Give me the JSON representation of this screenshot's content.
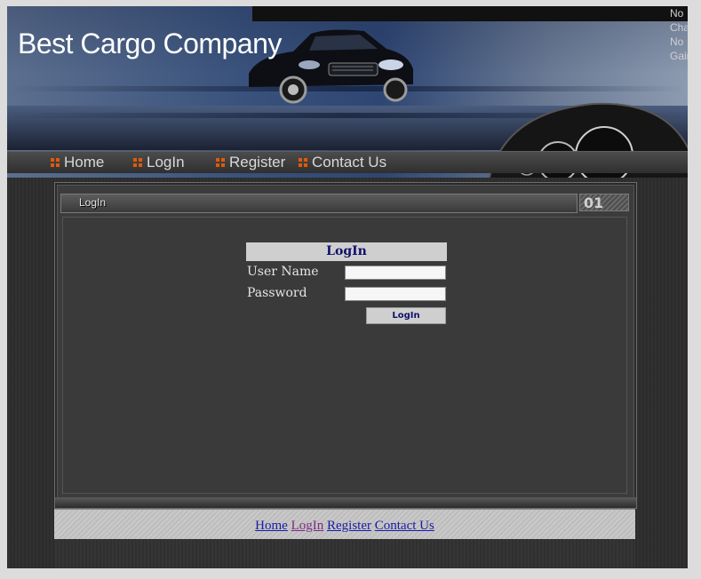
{
  "header": {
    "tagline": "No Chains, No Gains",
    "brand": "Best Cargo Company"
  },
  "nav": {
    "items": [
      {
        "label": "Home"
      },
      {
        "label": "LogIn"
      },
      {
        "label": "Register"
      },
      {
        "label": "Contact Us"
      }
    ]
  },
  "panel": {
    "title": "LogIn",
    "number": "01"
  },
  "login": {
    "heading": "LogIn",
    "username_label": "User Name",
    "username_value": "",
    "password_label": "Password",
    "password_value": "",
    "submit_label": "LogIn"
  },
  "footer": {
    "links": [
      {
        "label": "Home"
      },
      {
        "label": "LogIn"
      },
      {
        "label": "Register"
      },
      {
        "label": "Contact Us"
      }
    ]
  },
  "colors": {
    "nav_icon": "#e05a0a",
    "link": "#1a1aa6",
    "visited_link": "#7a2b84",
    "form_heading_text": "#11116b"
  }
}
